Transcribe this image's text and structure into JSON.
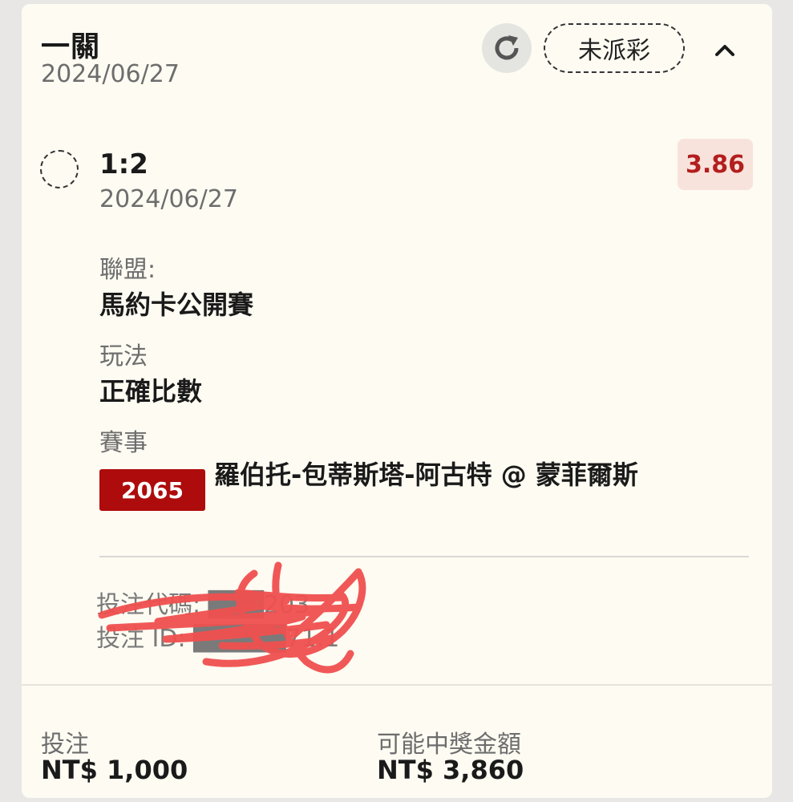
{
  "header": {
    "title": "一關",
    "date": "2024/06/27",
    "status": "未派彩"
  },
  "selection": {
    "name": "1:2",
    "date": "2024/06/27",
    "odds": "3.86",
    "league_label": "聯盟:",
    "league_value": "馬約卡公開賽",
    "market_label": "玩法",
    "market_value": "正確比數",
    "event_label": "賽事",
    "event_id": "2065",
    "event_name": "羅伯托-包蒂斯塔-阿古特 @ 蒙菲爾斯"
  },
  "meta": {
    "bet_code_line": "投注代碼: ███203",
    "bet_id_line": "投注 ID: █████71.1"
  },
  "footer": {
    "stake_label": "投注",
    "stake_value": "NT$ 1,000",
    "payout_label": "可能中獎金額",
    "payout_value": "NT$ 3,860"
  },
  "colors": {
    "accent_red": "#ae0c0c",
    "odds_text": "#b31e1e",
    "odds_bg": "#f8e3dc",
    "scribble": "#f0504f",
    "card_bg": "#fdfbf2"
  },
  "icons": {
    "refresh": "refresh-icon",
    "collapse": "chevron-up-icon",
    "selection": "radio-circle-icon"
  }
}
